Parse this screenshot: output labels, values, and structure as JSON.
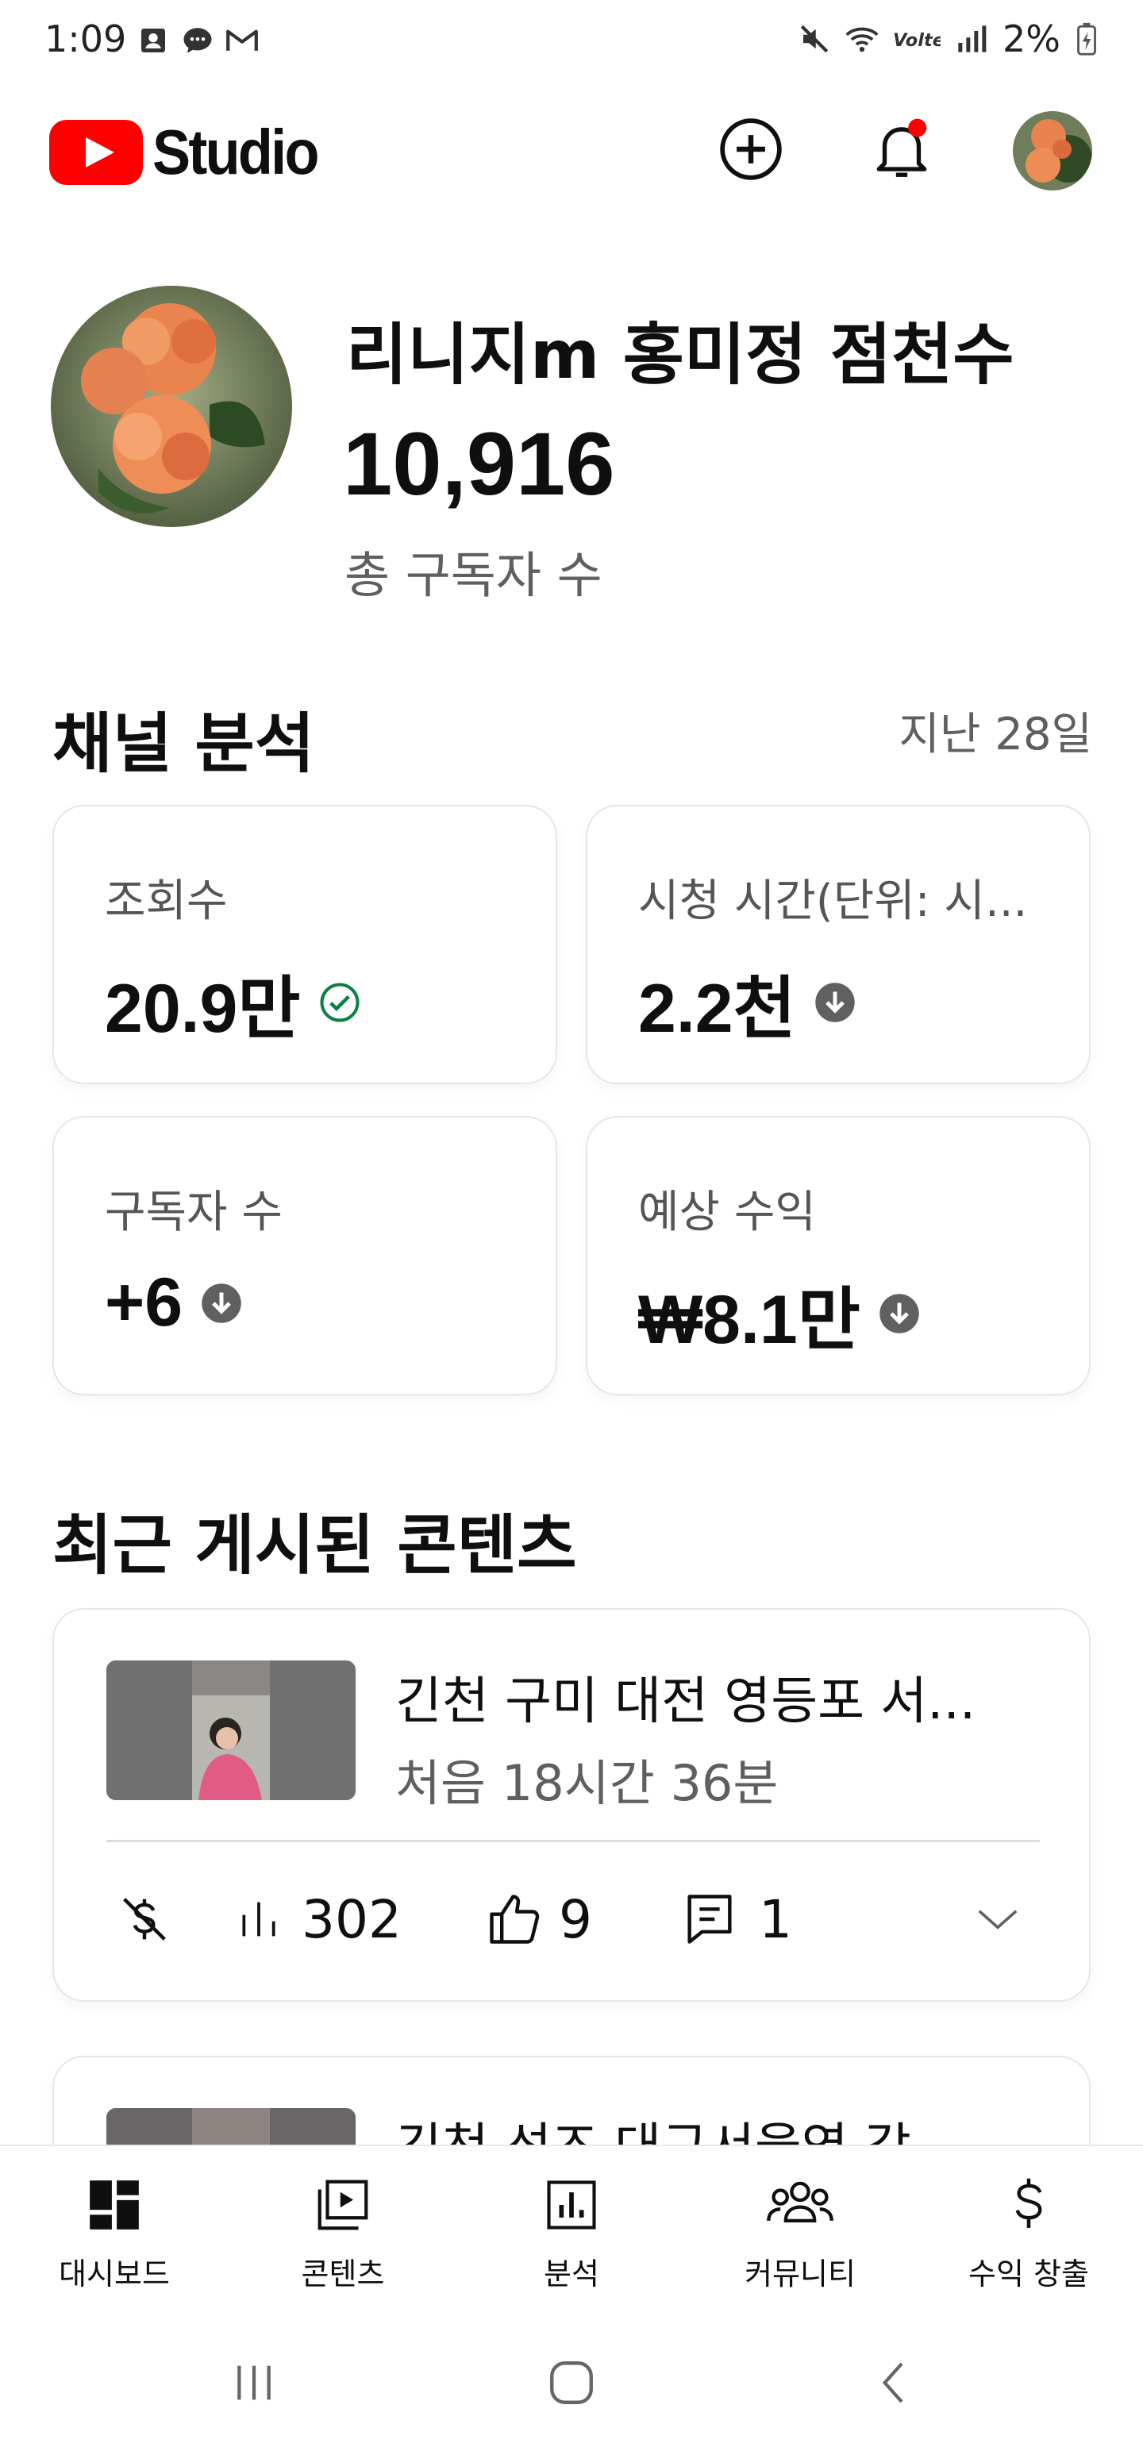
{
  "status_bar": {
    "time": "1:09",
    "battery": "2%",
    "icons": [
      "person-card-icon",
      "chat-bubble-icon",
      "gmail-icon",
      "mute-icon",
      "wifi-icon",
      "volte-icon",
      "signal-icon",
      "battery-charging-icon"
    ]
  },
  "app_bar": {
    "logo_text": "Studio",
    "create_icon": "add-circle-icon",
    "notifications_icon": "bell-icon",
    "notification_dot_color": "#ff0000",
    "brand_color": "#ff0000"
  },
  "channel": {
    "name": "리니지m 홍미정 점천수",
    "subscriber_count": "10,916",
    "subscriber_label": "총 구독자 수"
  },
  "analytics": {
    "title": "채널 분석",
    "period": "지난 28일",
    "cards": [
      {
        "label": "조회수",
        "value": "20.9만",
        "status_icon": "check-circle-icon",
        "status_color": "#0b8043"
      },
      {
        "label": "시청 시간(단위: 시...",
        "value": "2.2천",
        "status_icon": "arrow-down-circle-icon",
        "status_color": "#606060"
      },
      {
        "label": "구독자 수",
        "value": "+6",
        "status_icon": "arrow-down-circle-icon",
        "status_color": "#606060"
      },
      {
        "label": "예상 수익",
        "value": "₩8.1만",
        "status_icon": "arrow-down-circle-icon",
        "status_color": "#606060"
      }
    ]
  },
  "recent": {
    "title": "최근 게시된 콘텐츠",
    "items": [
      {
        "title": "긴천 구미 대전 영등포 서...",
        "time": "처음 18시간 36분",
        "monetization_icon": "monetization-off-icon",
        "views": "302",
        "likes": "9",
        "comments": "1"
      },
      {
        "title": "긴천 성즈 대구서울역 감"
      }
    ]
  },
  "bottom_nav": [
    {
      "label": "대시보드",
      "icon": "dashboard-icon",
      "active": true
    },
    {
      "label": "콘텐츠",
      "icon": "content-icon"
    },
    {
      "label": "분석",
      "icon": "analytics-icon"
    },
    {
      "label": "커뮤니티",
      "icon": "community-icon"
    },
    {
      "label": "수익 창출",
      "icon": "dollar-icon"
    }
  ],
  "system_nav": [
    "recents-icon",
    "home-icon",
    "back-icon"
  ]
}
